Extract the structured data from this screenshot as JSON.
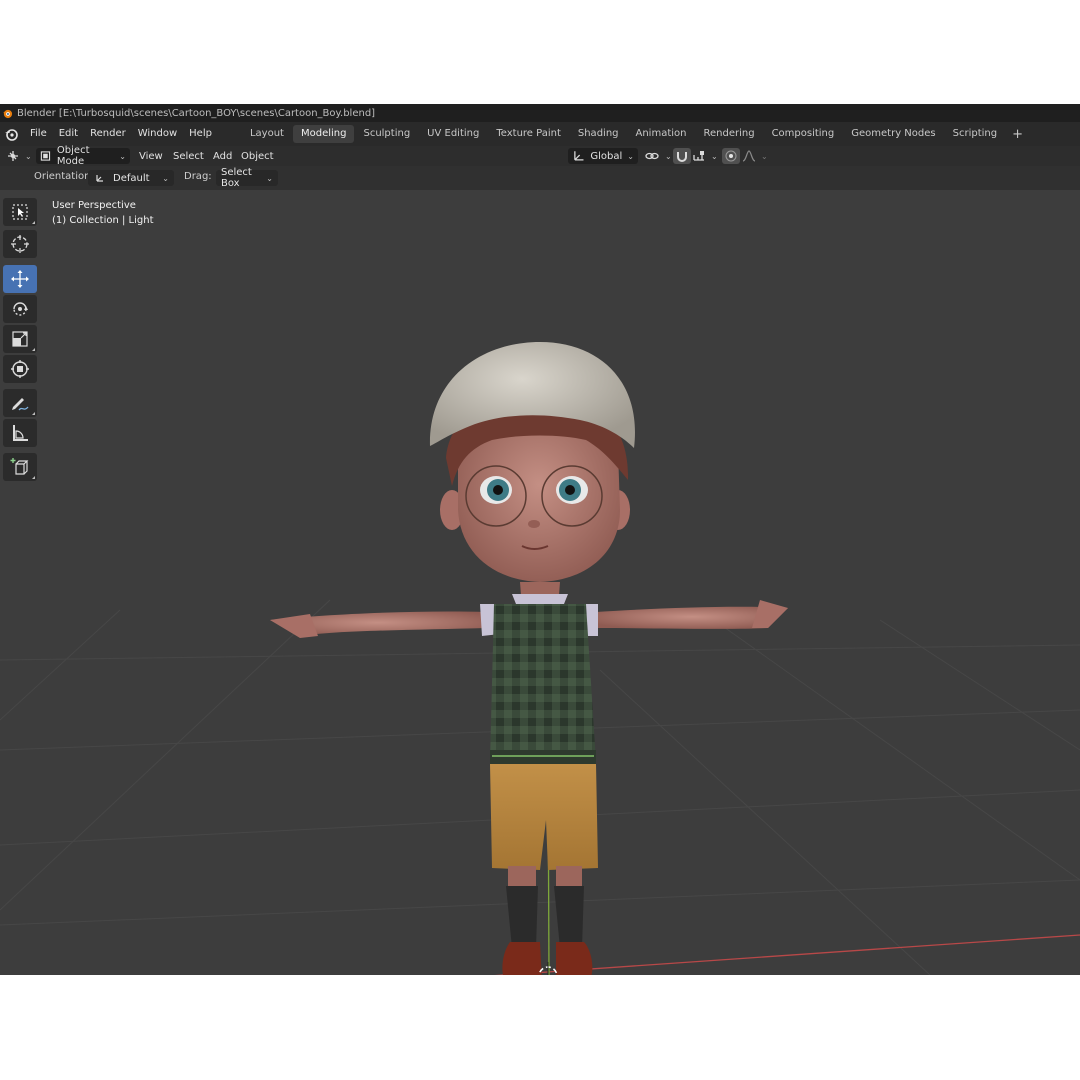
{
  "window": {
    "title": "Blender [E:\\Turbosquid\\scenes\\Cartoon_BOY\\scenes\\Cartoon_Boy.blend]"
  },
  "menu": [
    "File",
    "Edit",
    "Render",
    "Window",
    "Help"
  ],
  "workspaces": [
    {
      "label": "Layout",
      "active": false
    },
    {
      "label": "Modeling",
      "active": true
    },
    {
      "label": "Sculpting",
      "active": false
    },
    {
      "label": "UV Editing",
      "active": false
    },
    {
      "label": "Texture Paint",
      "active": false
    },
    {
      "label": "Shading",
      "active": false
    },
    {
      "label": "Animation",
      "active": false
    },
    {
      "label": "Rendering",
      "active": false
    },
    {
      "label": "Compositing",
      "active": false
    },
    {
      "label": "Geometry Nodes",
      "active": false
    },
    {
      "label": "Scripting",
      "active": false
    }
  ],
  "workspace_add": "+",
  "header": {
    "mode": "Object Mode",
    "view": "View",
    "select": "Select",
    "add": "Add",
    "object": "Object",
    "transform_orientation": "Global"
  },
  "tool_settings": {
    "orientation_label": "Orientation:",
    "orientation_value": "Default",
    "drag_label": "Drag:",
    "drag_value": "Select Box"
  },
  "viewport": {
    "perspective": "User Perspective",
    "collection": "(1) Collection | Light"
  },
  "tools": [
    {
      "name": "select-box-tool",
      "active": false
    },
    {
      "name": "cursor-tool",
      "active": false
    },
    {
      "name": "move-tool",
      "active": true
    },
    {
      "name": "rotate-tool",
      "active": false
    },
    {
      "name": "scale-tool",
      "active": false
    },
    {
      "name": "transform-tool",
      "active": false
    },
    {
      "name": "annotate-tool",
      "active": false
    },
    {
      "name": "measure-tool",
      "active": false
    },
    {
      "name": "add-cube-tool",
      "active": false
    }
  ],
  "colors": {
    "accent": "#4772b3",
    "x_axis": "#b84848",
    "y_axis": "#7ea83a",
    "viewport_bg": "#3d3d3d"
  }
}
